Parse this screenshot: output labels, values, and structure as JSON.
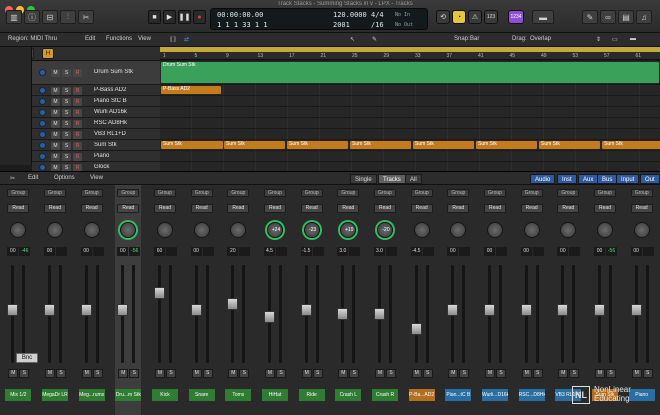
{
  "window": {
    "title": "Track Stacks - Summing Stacks in v - LPX - Tracks"
  },
  "transport": {
    "position_time": "00:00:00.00",
    "position_bars": "1  1  1    33  1  1",
    "tempo": "120.0000",
    "time_signature": "4/4",
    "division": "/16",
    "sample_rate_label": "2001",
    "midi_in_label": "No In",
    "midi_out_label": "No Out",
    "count_label": "1234",
    "tuner_label": "123"
  },
  "control_bar": {
    "region_label": "Region: MIDI Thru",
    "edit_menu": "Edit",
    "functions_menu": "Functions",
    "view_menu": "View",
    "snap_label": "Snap:",
    "snap_value": "Bar",
    "drag_label": "Drag:",
    "drag_value": "Overlap"
  },
  "ruler": {
    "marks": [
      "1",
      "5",
      "9",
      "13",
      "17",
      "21",
      "25",
      "29",
      "33",
      "37",
      "41",
      "45",
      "49",
      "53",
      "57",
      "61"
    ]
  },
  "tracks": [
    {
      "number": "1",
      "name": "Drum Sum Stk",
      "index": "A22",
      "region": "Drum Sum Stk"
    },
    {
      "number": "2",
      "name": "P-Bass AD2",
      "region": "P-Bass AD2"
    },
    {
      "number": "3",
      "name": "Piano StC B"
    },
    {
      "number": "4",
      "name": "Wurli AD16k"
    },
    {
      "number": "5",
      "name": "RSC AD8Hk"
    },
    {
      "number": "6",
      "name": "VB3 RL1+D"
    },
    {
      "number": "7",
      "name": "Sum Stk",
      "region": "Sum Stk"
    },
    {
      "number": "8",
      "name": "Piano"
    },
    {
      "number": "9",
      "name": "Glock"
    }
  ],
  "track_buttons": {
    "mute": "M",
    "solo": "S",
    "record": "R"
  },
  "mixer": {
    "edit_menu": "Edit",
    "options_menu": "Options",
    "view_menu": "View",
    "view_modes": [
      "Single",
      "Tracks",
      "All"
    ],
    "filters": [
      "Audio",
      "Inst",
      "Aux",
      "Bus",
      "Input",
      "Out"
    ],
    "group_label": "Group",
    "read_label": "Read",
    "mute_label": "M",
    "solo_label": "S",
    "strips": [
      {
        "name": "Mix 1/2",
        "vol": "00",
        "peak": "-46",
        "knob": "",
        "color": "#2e7d32"
      },
      {
        "name": "MegaDr LR",
        "vol": "00",
        "peak": "",
        "knob": "",
        "color": "#2e7d32"
      },
      {
        "name": "Meg...rums",
        "vol": "00",
        "peak": "",
        "knob": "",
        "color": "#2e7d32"
      },
      {
        "name": "Dru...m Stk",
        "vol": "00",
        "peak": "-56",
        "knob": "",
        "color": "#2e7d32"
      },
      {
        "name": "Kick",
        "vol": "60",
        "peak": "",
        "knob": "",
        "color": "#2e7d32"
      },
      {
        "name": "Snare",
        "vol": "00",
        "peak": "",
        "knob": "",
        "color": "#2e7d32"
      },
      {
        "name": "Toms",
        "vol": "20",
        "peak": "",
        "knob": "",
        "color": "#2e7d32"
      },
      {
        "name": "HiHat",
        "vol": "4.5",
        "peak": "",
        "knob": "+24",
        "color": "#2e7d32"
      },
      {
        "name": "Ride",
        "vol": "-1.5",
        "peak": "",
        "knob": "-23",
        "color": "#2e7d32"
      },
      {
        "name": "Crash L",
        "vol": "3.0",
        "peak": "",
        "knob": "+19",
        "color": "#2e7d32"
      },
      {
        "name": "Crash R",
        "vol": "3.0",
        "peak": "",
        "knob": "-20",
        "color": "#2e7d32"
      },
      {
        "name": "P-Ba...AD2",
        "vol": "-4.5",
        "peak": "",
        "knob": "",
        "color": "#b46f1e"
      },
      {
        "name": "Pian...tC B",
        "vol": "00",
        "peak": "",
        "knob": "",
        "color": "#2a6fa3"
      },
      {
        "name": "Wurli...D16k",
        "vol": "00",
        "peak": "",
        "knob": "",
        "color": "#2a6fa3"
      },
      {
        "name": "RSC...D8Hk",
        "vol": "00",
        "peak": "",
        "knob": "",
        "color": "#2a6fa3"
      },
      {
        "name": "VB3 RL1+D",
        "vol": "00",
        "peak": "",
        "knob": "",
        "color": "#2a6fa3"
      },
      {
        "name": "Sum Stk",
        "vol": "00",
        "peak": "-56",
        "knob": "",
        "color": "#b46f1e"
      },
      {
        "name": "Piano",
        "vol": "00",
        "peak": "",
        "knob": "",
        "color": "#2a6fa3"
      }
    ],
    "fader_levels": [
      0.55,
      0.55,
      0.55,
      0.55,
      0.75,
      0.55,
      0.62,
      0.47,
      0.55,
      0.5,
      0.5,
      0.33,
      0.55,
      0.55,
      0.55,
      0.55,
      0.55,
      0.55
    ],
    "tooltip": "Bnc"
  },
  "watermark": {
    "logo": "NL",
    "text": "NonLinear\nEducating"
  }
}
